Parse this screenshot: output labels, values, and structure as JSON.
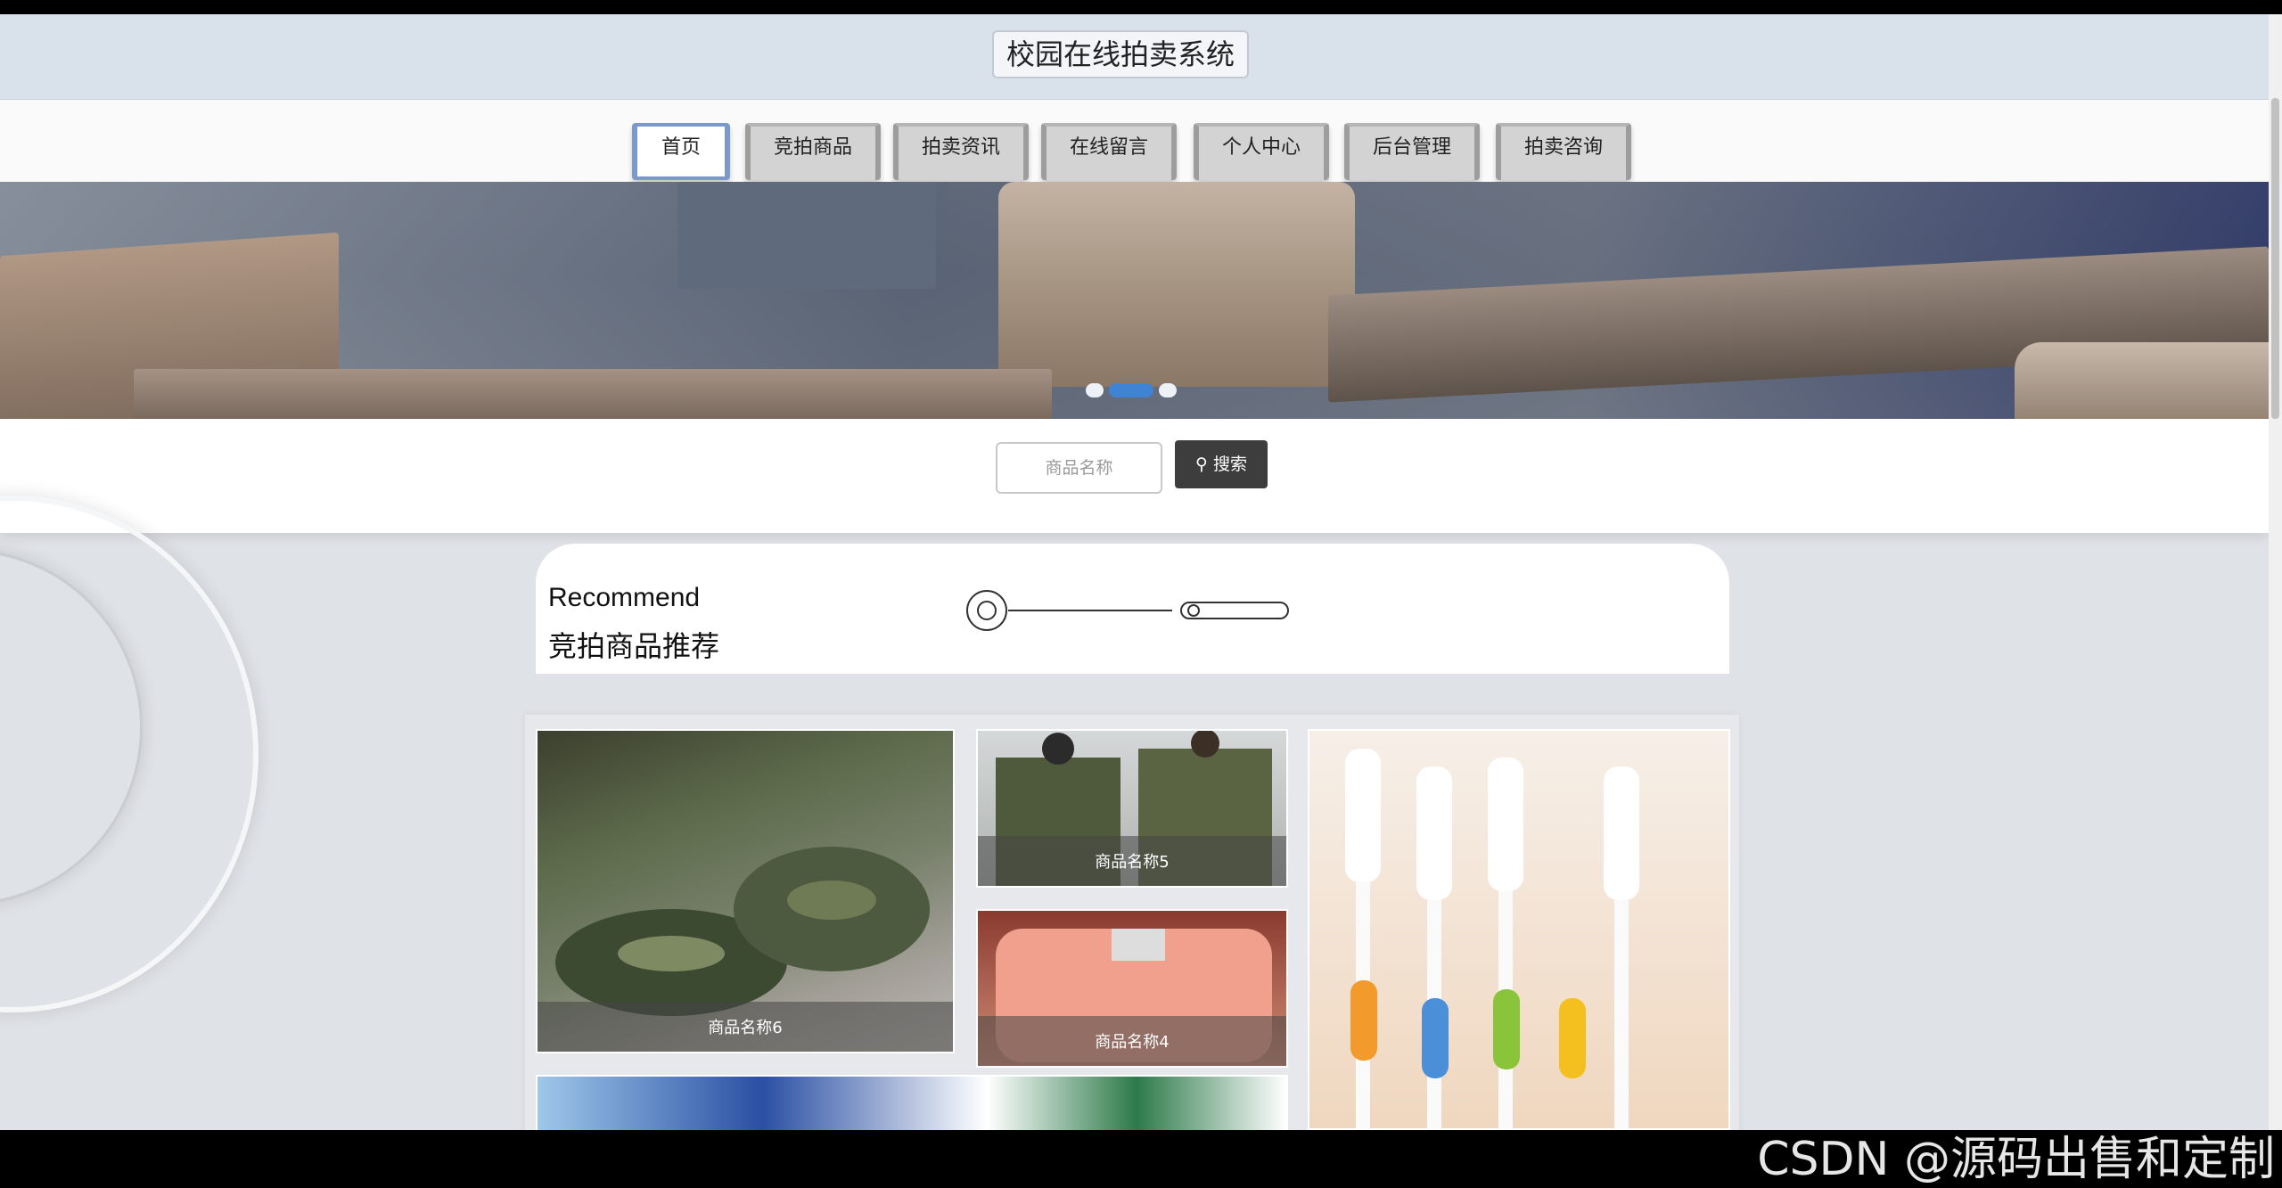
{
  "header": {
    "title": "校园在线拍卖系统"
  },
  "nav": {
    "items": [
      {
        "label": "首页",
        "active": true
      },
      {
        "label": "竞拍商品",
        "active": false
      },
      {
        "label": "拍卖资讯",
        "active": false
      },
      {
        "label": "在线留言",
        "active": false
      },
      {
        "label": "个人中心",
        "active": false
      },
      {
        "label": "后台管理",
        "active": false
      },
      {
        "label": "拍卖咨询",
        "active": false
      }
    ]
  },
  "banner": {
    "active_slide": 2,
    "slide_count": 3
  },
  "search": {
    "placeholder": "商品名称",
    "button_label": "搜索"
  },
  "recommend": {
    "title_en": "Recommend",
    "title_cn": "竞拍商品推荐"
  },
  "products": [
    {
      "caption": "商品名称6"
    },
    {
      "caption": "商品名称5"
    },
    {
      "caption": "商品名称4"
    }
  ],
  "watermark": "CSDN @源码出售和定制"
}
